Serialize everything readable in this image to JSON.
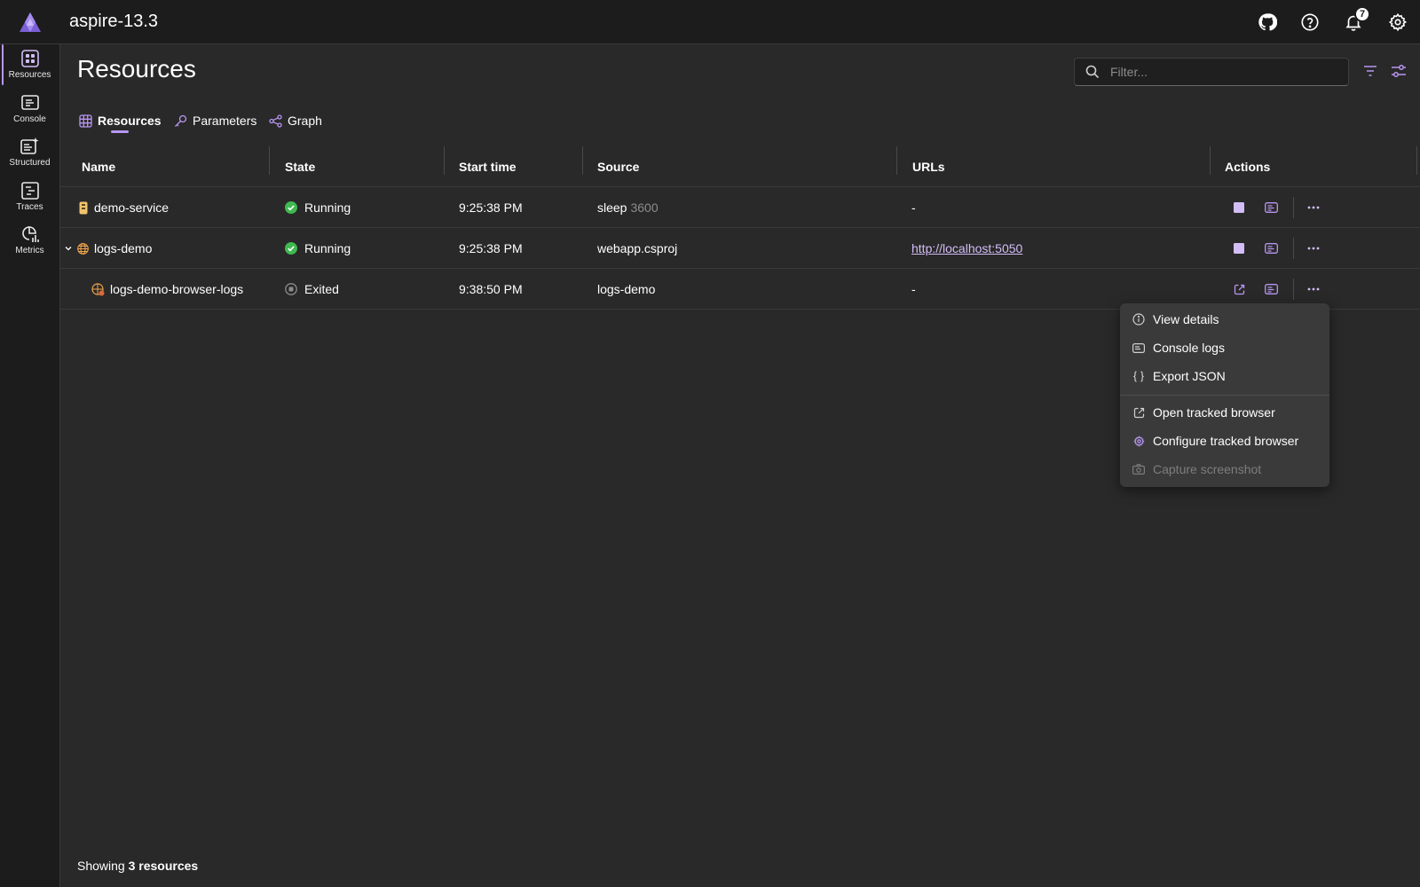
{
  "app": {
    "title": "aspire-13.3",
    "notification_count": "7"
  },
  "sidenav": {
    "items": [
      {
        "label": "Resources",
        "icon": "resources-icon"
      },
      {
        "label": "Console",
        "icon": "console-icon"
      },
      {
        "label": "Structured",
        "icon": "structured-icon"
      },
      {
        "label": "Traces",
        "icon": "traces-icon"
      },
      {
        "label": "Metrics",
        "icon": "metrics-icon"
      }
    ]
  },
  "page": {
    "title": "Resources"
  },
  "filter": {
    "placeholder": "Filter...",
    "value": ""
  },
  "tabs": [
    {
      "label": "Resources",
      "icon": "grid-icon",
      "active": true
    },
    {
      "label": "Parameters",
      "icon": "key-icon"
    },
    {
      "label": "Graph",
      "icon": "graph-icon"
    }
  ],
  "table": {
    "columns": [
      "Name",
      "State",
      "Start time",
      "Source",
      "URLs",
      "Actions"
    ],
    "rows": [
      {
        "name": "demo-service",
        "state": "Running",
        "start_time": "9:25:38 PM",
        "source": "sleep",
        "source_args": "3600",
        "url": "-"
      },
      {
        "name": "logs-demo",
        "state": "Running",
        "start_time": "9:25:38 PM",
        "source": "webapp.csproj",
        "source_args": "",
        "url": "http://localhost:5050"
      },
      {
        "name": "logs-demo-browser-logs",
        "state": "Exited",
        "start_time": "9:38:50 PM",
        "source": "logs-demo",
        "source_args": "",
        "url": "-"
      }
    ]
  },
  "context_menu": {
    "items": [
      {
        "label": "View details",
        "icon": "info-icon"
      },
      {
        "label": "Console logs",
        "icon": "console-logs-icon"
      },
      {
        "label": "Export JSON",
        "icon": "braces-icon"
      },
      {
        "label": "Open tracked browser",
        "icon": "open-external-icon"
      },
      {
        "label": "Configure tracked browser",
        "icon": "gear-icon"
      },
      {
        "label": "Capture screenshot",
        "icon": "camera-icon",
        "disabled": true
      }
    ]
  },
  "footer": {
    "prefix": "Showing",
    "count_text": "3 resources"
  },
  "colors": {
    "accent": "#b896f2",
    "running": "#3fb950",
    "background": "#292929",
    "chrome": "#1c1c1c"
  }
}
